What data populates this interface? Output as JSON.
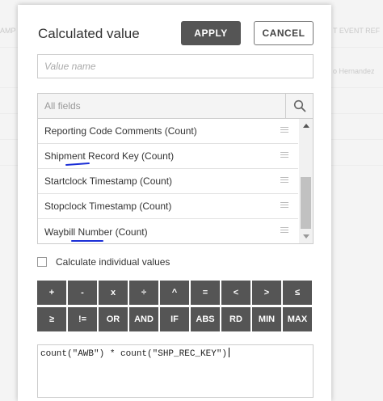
{
  "background": {
    "header_left": "AMP",
    "header_right": "T EVENT REF",
    "name_cell": "o Hernandez"
  },
  "modal": {
    "title": "Calculated value",
    "apply_label": "APPLY",
    "cancel_label": "CANCEL",
    "value_name_placeholder": "Value name",
    "value_name_value": "",
    "search_placeholder": "All fields",
    "fields": [
      {
        "label": "Reporting Code Comments (Count)"
      },
      {
        "label": "Shipment Record Key (Count)"
      },
      {
        "label": "Startclock Timestamp (Count)"
      },
      {
        "label": "Stopclock Timestamp (Count)"
      },
      {
        "label": "Waybill Number (Count)"
      }
    ],
    "calculate_individual_label": "Calculate individual values",
    "calculate_individual_checked": false,
    "keypad_row1": [
      "+",
      "-",
      "x",
      "÷",
      "^",
      "=",
      "<",
      ">",
      "≤"
    ],
    "keypad_row2": [
      "≥",
      "!=",
      "OR",
      "AND",
      "IF",
      "ABS",
      "RD",
      "MIN",
      "MAX"
    ],
    "formula": "count(\"AWB\") * count(\"SHP_REC_KEY\")"
  },
  "colors": {
    "primary_button": "#555555",
    "annotation_underline": "#1a2ed6"
  },
  "icons": {
    "search": "magnifier-icon",
    "drag_handle": "hamburger-icon"
  }
}
